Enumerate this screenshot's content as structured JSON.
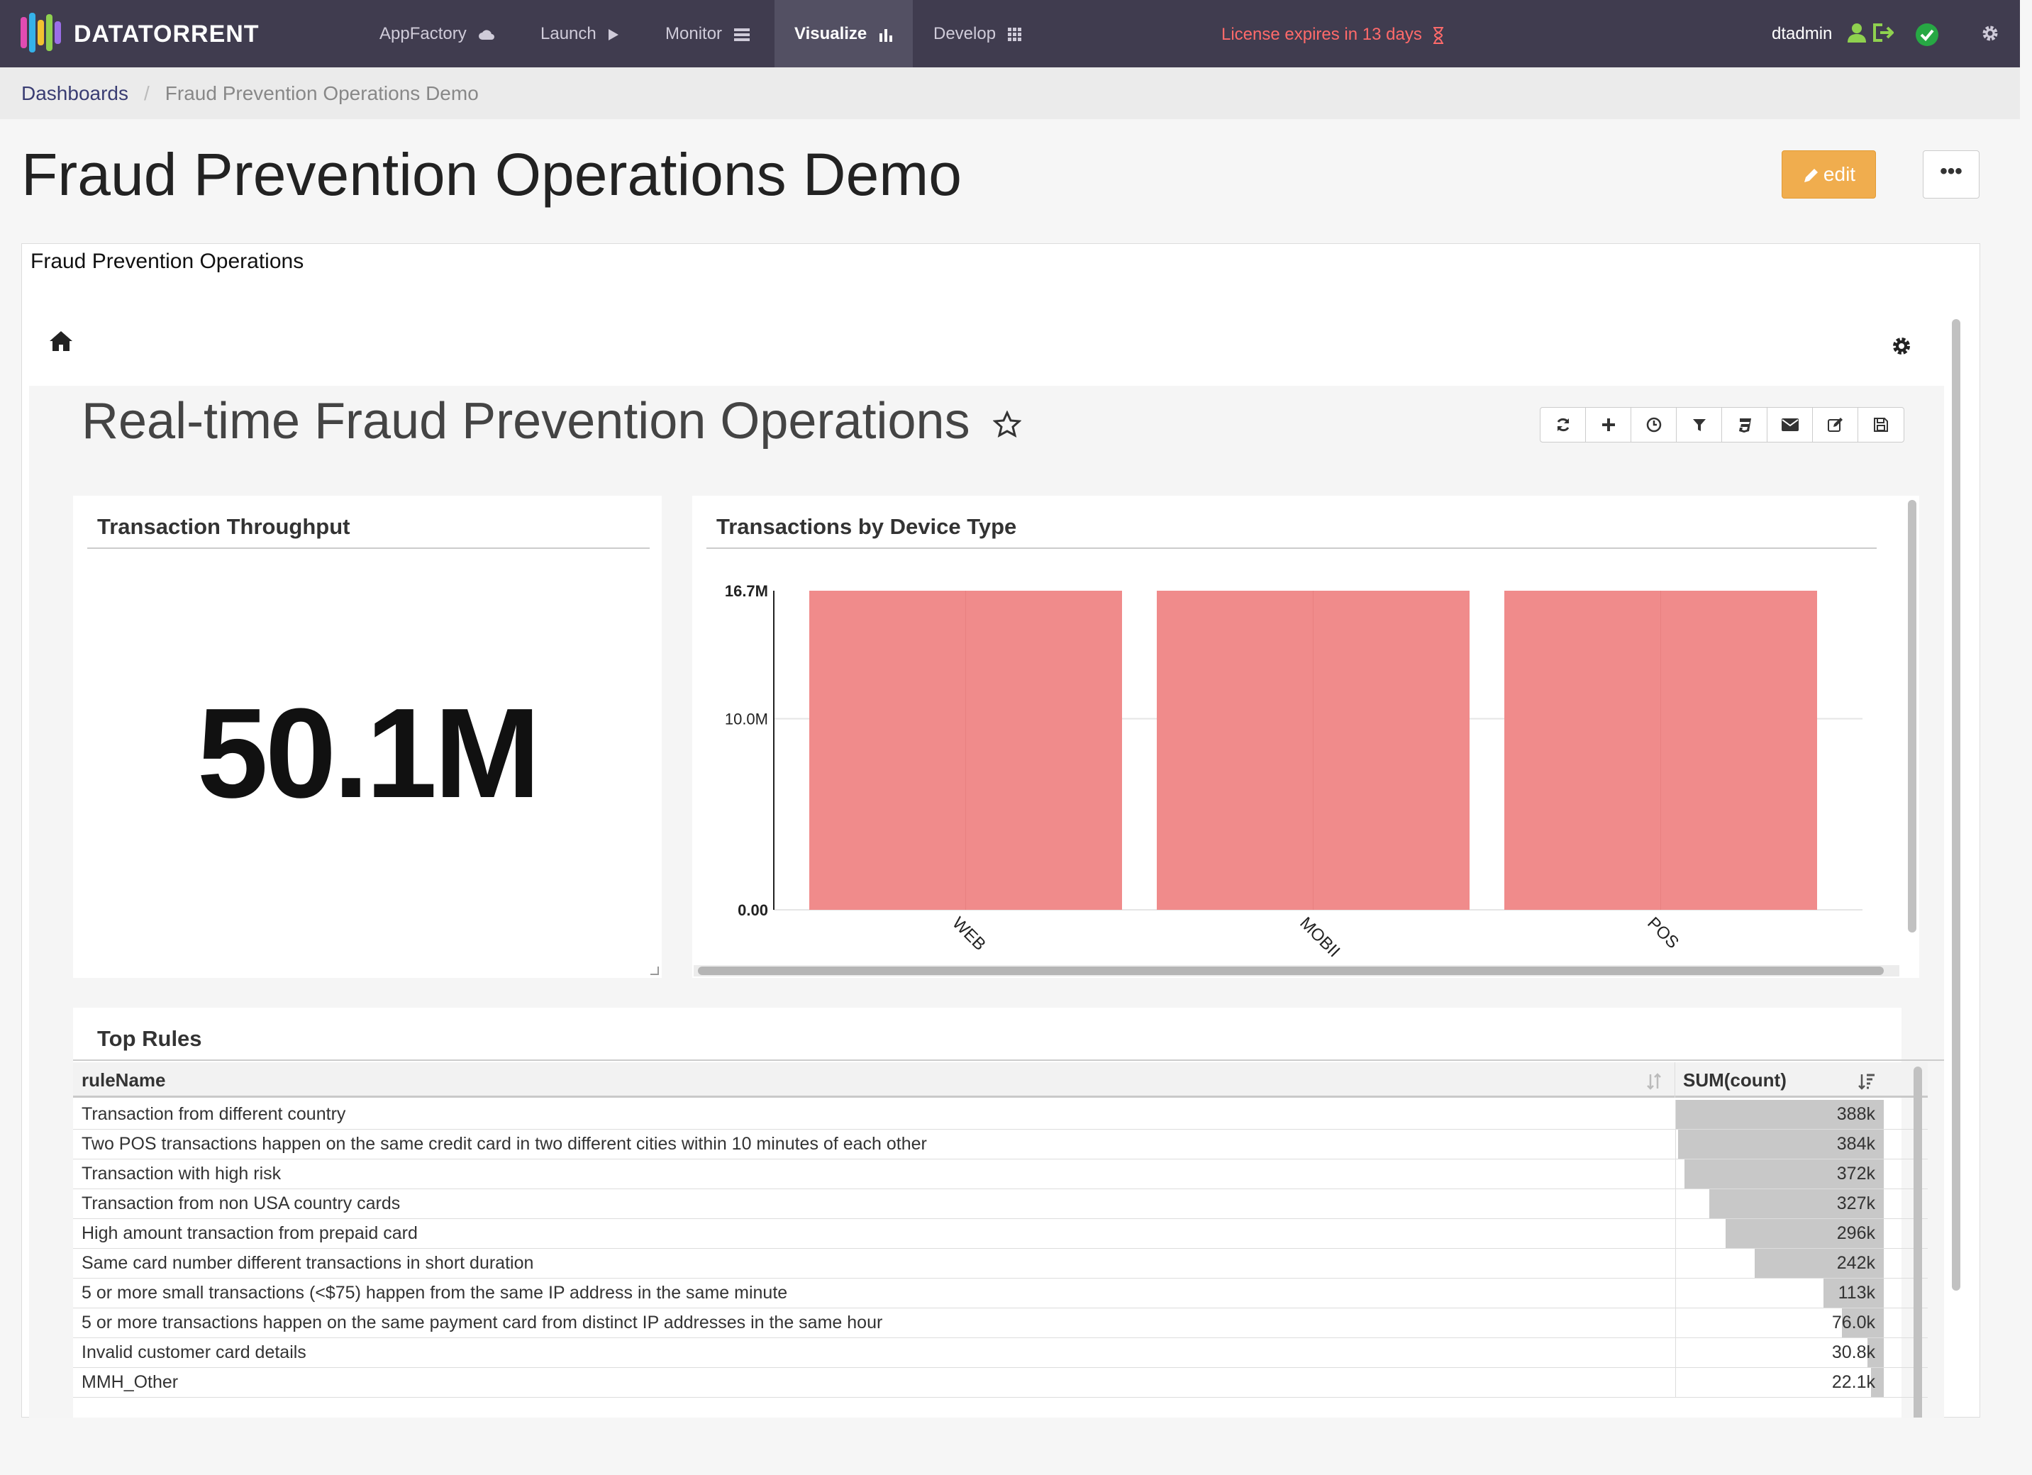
{
  "navbar": {
    "brand": "DATATORRENT",
    "items": [
      {
        "label": "AppFactory",
        "icon": "cloud-icon"
      },
      {
        "label": "Launch",
        "icon": "play-icon"
      },
      {
        "label": "Monitor",
        "icon": "server-icon"
      },
      {
        "label": "Visualize",
        "icon": "bar-chart-icon",
        "active": true
      },
      {
        "label": "Develop",
        "icon": "grid-icon"
      }
    ],
    "license": "License expires in 13 days",
    "user": "dtadmin"
  },
  "breadcrumb": {
    "root": "Dashboards",
    "current": "Fraud Prevention Operations Demo"
  },
  "page": {
    "title": "Fraud Prevention Operations Demo",
    "edit_label": "edit",
    "more_label": "•••"
  },
  "panel": {
    "title": "Fraud Prevention Operations"
  },
  "dashboard": {
    "title": "Real-time Fraud Prevention Operations"
  },
  "widgets": {
    "throughput": {
      "title": "Transaction Throughput",
      "value": "50.1M"
    },
    "device": {
      "title": "Transactions by Device Type"
    },
    "rules": {
      "title": "Top Rules",
      "col_name": "ruleName",
      "col_sum": "SUM(count)"
    }
  },
  "chart_data": {
    "type": "bar",
    "title": "Transactions by Device Type",
    "categories": [
      "WEB",
      "MOBILE",
      "POS"
    ],
    "category_labels": [
      "WEB",
      "MOBII",
      "POS"
    ],
    "values": [
      16.7,
      16.7,
      16.7
    ],
    "unit": "M",
    "ylim": [
      0,
      16.7
    ],
    "yticks": [
      "0.00",
      "10.0M",
      "16.7M"
    ],
    "grid": true,
    "color": "#f08b8b"
  },
  "top_rules": [
    {
      "name": "Transaction from different country",
      "value": "388k",
      "fraction": 1.0
    },
    {
      "name": "Two POS transactions happen on the same credit card in two different cities within 10 minutes of each other",
      "value": "384k",
      "fraction": 0.99
    },
    {
      "name": "Transaction with high risk",
      "value": "372k",
      "fraction": 0.96
    },
    {
      "name": "Transaction from non USA country cards",
      "value": "327k",
      "fraction": 0.84
    },
    {
      "name": "High amount transaction from prepaid card",
      "value": "296k",
      "fraction": 0.76
    },
    {
      "name": "Same card number different transactions in short duration",
      "value": "242k",
      "fraction": 0.62
    },
    {
      "name": "5 or more small transactions (<$75) happen from the same IP address in the same minute",
      "value": "113k",
      "fraction": 0.29
    },
    {
      "name": "5 or more transactions happen on the same payment card from distinct IP addresses in the same hour",
      "value": "76.0k",
      "fraction": 0.2
    },
    {
      "name": "Invalid customer card details",
      "value": "30.8k",
      "fraction": 0.08
    },
    {
      "name": "MMH_Other",
      "value": "22.1k",
      "fraction": 0.06
    }
  ]
}
